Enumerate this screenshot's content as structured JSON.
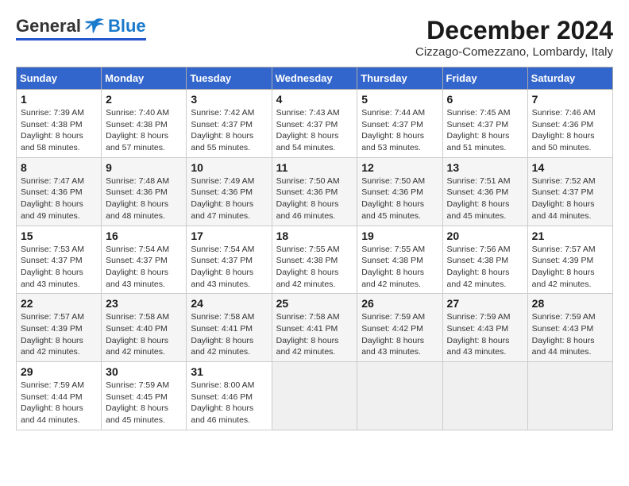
{
  "header": {
    "logo": {
      "general": "General",
      "blue": "Blue"
    },
    "title": "December 2024",
    "location": "Cizzago-Comezzano, Lombardy, Italy"
  },
  "calendar": {
    "days_of_week": [
      "Sunday",
      "Monday",
      "Tuesday",
      "Wednesday",
      "Thursday",
      "Friday",
      "Saturday"
    ],
    "weeks": [
      [
        null,
        {
          "day": "2",
          "sunrise": "7:40 AM",
          "sunset": "4:38 PM",
          "daylight": "8 hours and 57 minutes."
        },
        {
          "day": "3",
          "sunrise": "7:42 AM",
          "sunset": "4:37 PM",
          "daylight": "8 hours and 55 minutes."
        },
        {
          "day": "4",
          "sunrise": "7:43 AM",
          "sunset": "4:37 PM",
          "daylight": "8 hours and 54 minutes."
        },
        {
          "day": "5",
          "sunrise": "7:44 AM",
          "sunset": "4:37 PM",
          "daylight": "8 hours and 53 minutes."
        },
        {
          "day": "6",
          "sunrise": "7:45 AM",
          "sunset": "4:37 PM",
          "daylight": "8 hours and 51 minutes."
        },
        {
          "day": "7",
          "sunrise": "7:46 AM",
          "sunset": "4:36 PM",
          "daylight": "8 hours and 50 minutes."
        }
      ],
      [
        {
          "day": "1",
          "sunrise": "7:39 AM",
          "sunset": "4:38 PM",
          "daylight": "8 hours and 58 minutes."
        },
        {
          "day": "9",
          "sunrise": "7:48 AM",
          "sunset": "4:36 PM",
          "daylight": "8 hours and 48 minutes."
        },
        {
          "day": "10",
          "sunrise": "7:49 AM",
          "sunset": "4:36 PM",
          "daylight": "8 hours and 47 minutes."
        },
        {
          "day": "11",
          "sunrise": "7:50 AM",
          "sunset": "4:36 PM",
          "daylight": "8 hours and 46 minutes."
        },
        {
          "day": "12",
          "sunrise": "7:50 AM",
          "sunset": "4:36 PM",
          "daylight": "8 hours and 45 minutes."
        },
        {
          "day": "13",
          "sunrise": "7:51 AM",
          "sunset": "4:36 PM",
          "daylight": "8 hours and 45 minutes."
        },
        {
          "day": "14",
          "sunrise": "7:52 AM",
          "sunset": "4:37 PM",
          "daylight": "8 hours and 44 minutes."
        }
      ],
      [
        {
          "day": "8",
          "sunrise": "7:47 AM",
          "sunset": "4:36 PM",
          "daylight": "8 hours and 49 minutes."
        },
        {
          "day": "16",
          "sunrise": "7:54 AM",
          "sunset": "4:37 PM",
          "daylight": "8 hours and 43 minutes."
        },
        {
          "day": "17",
          "sunrise": "7:54 AM",
          "sunset": "4:37 PM",
          "daylight": "8 hours and 43 minutes."
        },
        {
          "day": "18",
          "sunrise": "7:55 AM",
          "sunset": "4:38 PM",
          "daylight": "8 hours and 42 minutes."
        },
        {
          "day": "19",
          "sunrise": "7:55 AM",
          "sunset": "4:38 PM",
          "daylight": "8 hours and 42 minutes."
        },
        {
          "day": "20",
          "sunrise": "7:56 AM",
          "sunset": "4:38 PM",
          "daylight": "8 hours and 42 minutes."
        },
        {
          "day": "21",
          "sunrise": "7:57 AM",
          "sunset": "4:39 PM",
          "daylight": "8 hours and 42 minutes."
        }
      ],
      [
        {
          "day": "15",
          "sunrise": "7:53 AM",
          "sunset": "4:37 PM",
          "daylight": "8 hours and 43 minutes."
        },
        {
          "day": "23",
          "sunrise": "7:58 AM",
          "sunset": "4:40 PM",
          "daylight": "8 hours and 42 minutes."
        },
        {
          "day": "24",
          "sunrise": "7:58 AM",
          "sunset": "4:41 PM",
          "daylight": "8 hours and 42 minutes."
        },
        {
          "day": "25",
          "sunrise": "7:58 AM",
          "sunset": "4:41 PM",
          "daylight": "8 hours and 42 minutes."
        },
        {
          "day": "26",
          "sunrise": "7:59 AM",
          "sunset": "4:42 PM",
          "daylight": "8 hours and 43 minutes."
        },
        {
          "day": "27",
          "sunrise": "7:59 AM",
          "sunset": "4:43 PM",
          "daylight": "8 hours and 43 minutes."
        },
        {
          "day": "28",
          "sunrise": "7:59 AM",
          "sunset": "4:43 PM",
          "daylight": "8 hours and 44 minutes."
        }
      ],
      [
        {
          "day": "22",
          "sunrise": "7:57 AM",
          "sunset": "4:39 PM",
          "daylight": "8 hours and 42 minutes."
        },
        {
          "day": "30",
          "sunrise": "7:59 AM",
          "sunset": "4:45 PM",
          "daylight": "8 hours and 45 minutes."
        },
        {
          "day": "31",
          "sunrise": "8:00 AM",
          "sunset": "4:46 PM",
          "daylight": "8 hours and 46 minutes."
        },
        null,
        null,
        null,
        null
      ],
      [
        {
          "day": "29",
          "sunrise": "7:59 AM",
          "sunset": "4:44 PM",
          "daylight": "8 hours and 44 minutes."
        },
        null,
        null,
        null,
        null,
        null,
        null
      ]
    ],
    "week_starts": [
      [
        null,
        2,
        3,
        4,
        5,
        6,
        7
      ],
      [
        1,
        9,
        10,
        11,
        12,
        13,
        14
      ],
      [
        8,
        16,
        17,
        18,
        19,
        20,
        21
      ],
      [
        15,
        23,
        24,
        25,
        26,
        27,
        28
      ],
      [
        22,
        30,
        31,
        null,
        null,
        null,
        null
      ],
      [
        29,
        null,
        null,
        null,
        null,
        null,
        null
      ]
    ]
  }
}
